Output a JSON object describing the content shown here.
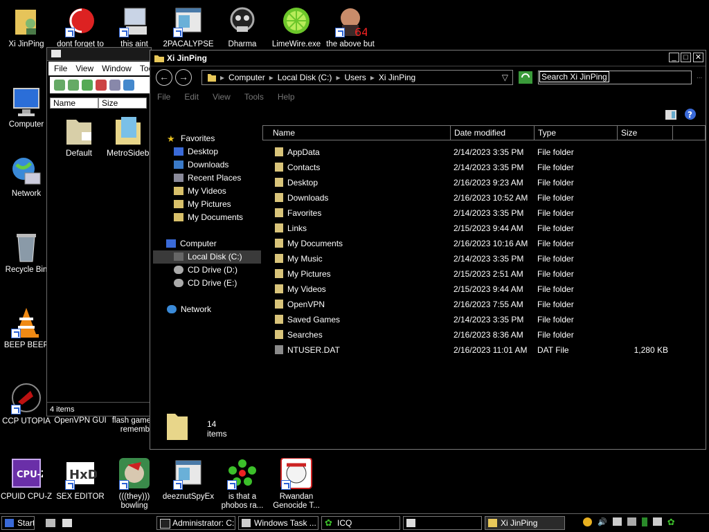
{
  "desktop": {
    "icons": [
      {
        "label": "Xi JinPing"
      },
      {
        "label": "dont forget to"
      },
      {
        "label": "this aint"
      },
      {
        "label": "2PACALYPSE"
      },
      {
        "label": "Dharma"
      },
      {
        "label": "LimeWire.exe"
      },
      {
        "label": "the above but"
      },
      {
        "label": "Computer"
      },
      {
        "label": "Network"
      },
      {
        "label": "Recycle Bin"
      },
      {
        "label": "BEEP BEEP"
      },
      {
        "label": "CCP UTOPIA"
      },
      {
        "label": "OpenVPN GUI"
      },
      {
        "label": "flash game"
      },
      {
        "label": "remember"
      },
      {
        "label": "CPUID CPU-Z"
      },
      {
        "label": "SEX EDITOR"
      },
      {
        "label": "(((they)))"
      },
      {
        "label": "bowling"
      },
      {
        "label": "deeznutSpyEx"
      },
      {
        "label": "is that a"
      },
      {
        "label": "phobos ra..."
      },
      {
        "label": "Rwandan"
      },
      {
        "label": "Genocide T..."
      }
    ]
  },
  "back_window": {
    "menu": [
      "File",
      "View",
      "Window",
      "Tools"
    ],
    "columns": [
      "Name",
      "Size"
    ],
    "items": [
      {
        "label": "Default"
      },
      {
        "label": "MetroSideba"
      }
    ],
    "status": "4 items"
  },
  "explorer": {
    "title": "Xi JinPing",
    "breadcrumb": [
      "Computer",
      "Local Disk (C:)",
      "Users",
      "Xi JinPing"
    ],
    "search_placeholder": "Search Xi JinPing",
    "menu": [
      "File",
      "Edit",
      "View",
      "Tools",
      "Help"
    ],
    "nav": {
      "favorites_header": "Favorites",
      "favorites": [
        "Desktop",
        "Downloads",
        "Recent Places",
        "My Videos",
        "My Pictures",
        "My Documents"
      ],
      "computer_header": "Computer",
      "drives": [
        "Local Disk (C:)",
        "CD Drive (D:)",
        "CD Drive (E:)"
      ],
      "network_header": "Network"
    },
    "columns": [
      "Name",
      "Date modified",
      "Type",
      "Size"
    ],
    "rows": [
      {
        "name": "AppData",
        "date": "2/14/2023 3:35 PM",
        "type": "File folder",
        "size": ""
      },
      {
        "name": "Contacts",
        "date": "2/14/2023 3:35 PM",
        "type": "File folder",
        "size": ""
      },
      {
        "name": "Desktop",
        "date": "2/16/2023 9:23 AM",
        "type": "File folder",
        "size": ""
      },
      {
        "name": "Downloads",
        "date": "2/16/2023 10:52 AM",
        "type": "File folder",
        "size": ""
      },
      {
        "name": "Favorites",
        "date": "2/14/2023 3:35 PM",
        "type": "File folder",
        "size": ""
      },
      {
        "name": "Links",
        "date": "2/15/2023 9:44 AM",
        "type": "File folder",
        "size": ""
      },
      {
        "name": "My Documents",
        "date": "2/16/2023 10:16 AM",
        "type": "File folder",
        "size": ""
      },
      {
        "name": "My Music",
        "date": "2/14/2023 3:35 PM",
        "type": "File folder",
        "size": ""
      },
      {
        "name": "My Pictures",
        "date": "2/15/2023 2:51 AM",
        "type": "File folder",
        "size": ""
      },
      {
        "name": "My Videos",
        "date": "2/15/2023 9:44 AM",
        "type": "File folder",
        "size": ""
      },
      {
        "name": "OpenVPN",
        "date": "2/16/2023 7:55 AM",
        "type": "File folder",
        "size": ""
      },
      {
        "name": "Saved Games",
        "date": "2/14/2023 3:35 PM",
        "type": "File folder",
        "size": ""
      },
      {
        "name": "Searches",
        "date": "2/16/2023 8:36 AM",
        "type": "File folder",
        "size": ""
      },
      {
        "name": "NTUSER.DAT",
        "date": "2/16/2023 11:01 AM",
        "type": "DAT File",
        "size": "1,280 KB"
      }
    ],
    "item_count": "14 items"
  },
  "taskbar": {
    "start": "Start",
    "tasks": [
      "Administrator: C:...",
      "Windows Task ...",
      "ICQ",
      "",
      "Xi JinPing"
    ]
  }
}
